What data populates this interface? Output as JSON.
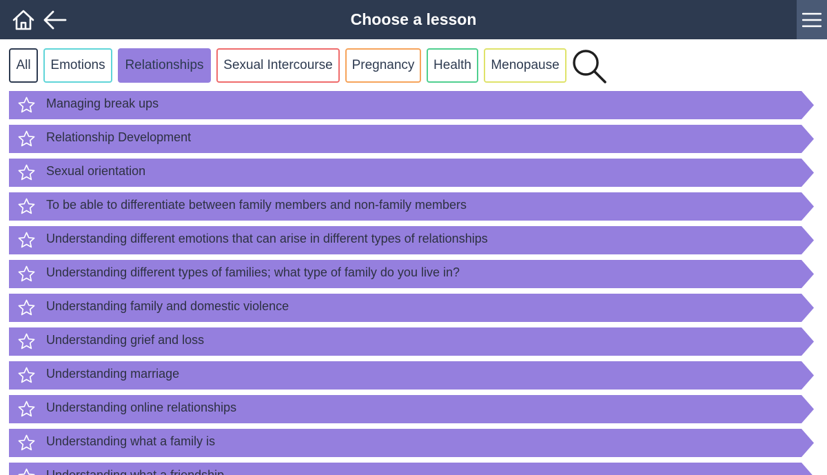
{
  "header": {
    "title": "Choose a lesson"
  },
  "filters": [
    {
      "label": "All",
      "border": "#2d3a50",
      "active": false
    },
    {
      "label": "Emotions",
      "border": "#5fd5d8",
      "active": false
    },
    {
      "label": "Relationships",
      "border": "#957fde",
      "active": true
    },
    {
      "label": "Sexual Intercourse",
      "border": "#ef6b6b",
      "active": false
    },
    {
      "label": "Pregnancy",
      "border": "#f6a35a",
      "active": false
    },
    {
      "label": "Health",
      "border": "#4fcf8f",
      "active": false
    },
    {
      "label": "Menopause",
      "border": "#dfe36a",
      "active": false
    }
  ],
  "lessons": [
    "Managing break ups",
    "Relationship Development",
    "Sexual orientation",
    "To be able to differentiate between family members and non-family members",
    "Understanding different emotions that can arise in different types of relationships",
    "Understanding different types of families; what type of family do you live in?",
    "Understanding family and domestic violence",
    "Understanding grief and loss",
    "Understanding marriage",
    "Understanding online relationships",
    "Understanding what a family is",
    "Understanding what a friendship"
  ],
  "colors": {
    "header_bg": "#2d3a50",
    "accent": "#957fde",
    "text_dark": "#2d3142"
  },
  "icons": {
    "home": "home-icon",
    "back": "arrow-left-icon",
    "menu": "hamburger-menu-icon",
    "search": "search-icon",
    "star": "star-outline-icon"
  }
}
